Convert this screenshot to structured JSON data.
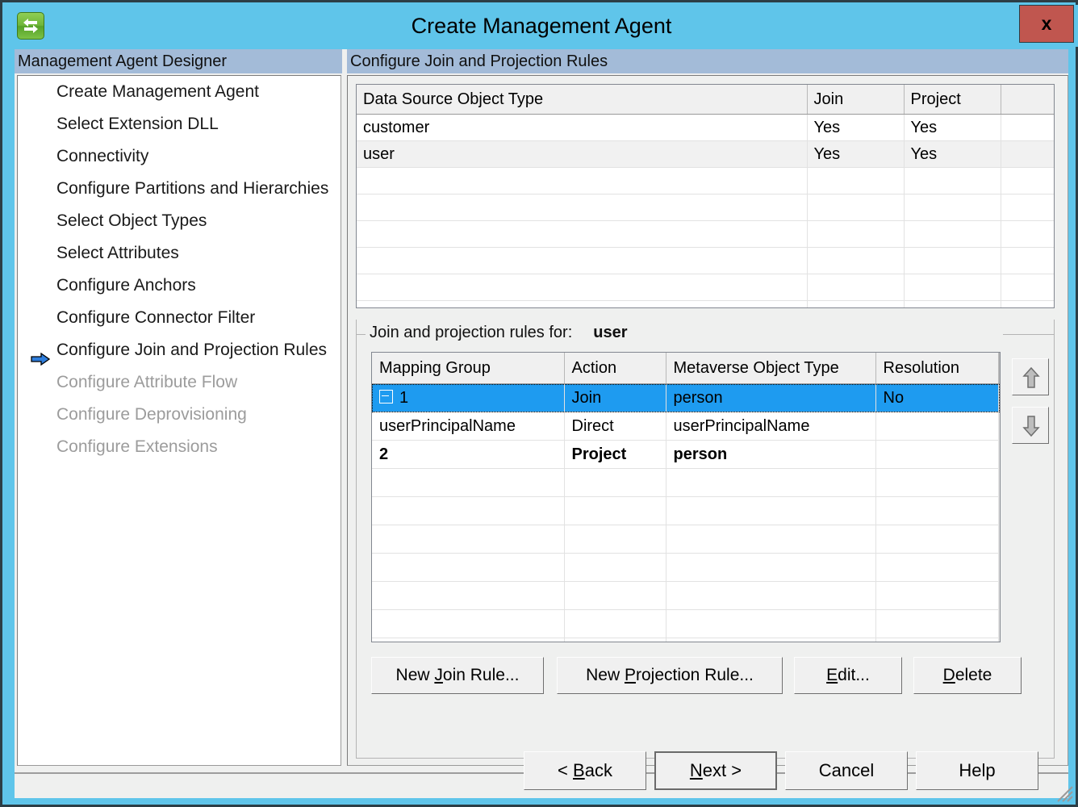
{
  "window": {
    "title": "Create Management Agent",
    "app_icon": "sync-arrows-icon",
    "close_label": "x",
    "accent_titlebar": "#5fc5ea",
    "accent_close": "#c0564f",
    "accent_header": "#a3bbd8",
    "accent_selection": "#1e9bf0"
  },
  "left_panel": {
    "header": "Management Agent Designer",
    "items": [
      {
        "label": "Create Management Agent",
        "state": "done",
        "current": false
      },
      {
        "label": "Select Extension DLL",
        "state": "done",
        "current": false
      },
      {
        "label": "Connectivity",
        "state": "done",
        "current": false
      },
      {
        "label": "Configure Partitions and Hierarchies",
        "state": "done",
        "current": false
      },
      {
        "label": "Select Object Types",
        "state": "done",
        "current": false
      },
      {
        "label": "Select Attributes",
        "state": "done",
        "current": false
      },
      {
        "label": "Configure Anchors",
        "state": "done",
        "current": false
      },
      {
        "label": "Configure Connector Filter",
        "state": "done",
        "current": false
      },
      {
        "label": "Configure Join and Projection Rules",
        "state": "done",
        "current": true
      },
      {
        "label": "Configure Attribute Flow",
        "state": "disabled",
        "current": false
      },
      {
        "label": "Configure Deprovisioning",
        "state": "disabled",
        "current": false
      },
      {
        "label": "Configure Extensions",
        "state": "disabled",
        "current": false
      }
    ]
  },
  "right_panel": {
    "header": "Configure Join and Projection Rules",
    "object_type_grid": {
      "columns": [
        "Data Source Object Type",
        "Join",
        "Project",
        ""
      ],
      "rows": [
        {
          "object_type": "customer",
          "join": "Yes",
          "project": "Yes",
          "blank": "",
          "selected": false
        },
        {
          "object_type": "user",
          "join": "Yes",
          "project": "Yes",
          "blank": "",
          "selected": true
        }
      ],
      "empty_row_count": 7
    },
    "groupbox": {
      "label": "Join and projection rules for:",
      "object": "user",
      "rules_grid": {
        "columns": [
          "Mapping Group",
          "Action",
          "Metaverse Object Type",
          "Resolution",
          ""
        ],
        "rows": [
          {
            "mapping_group": "1",
            "action": "Join",
            "metaverse_object_type": "person",
            "resolution": "No",
            "blank": "",
            "selected": true,
            "expandable": true,
            "child": false,
            "bold": false
          },
          {
            "mapping_group": "userPrincipalName",
            "action": "Direct",
            "metaverse_object_type": "userPrincipalName",
            "resolution": "",
            "blank": "",
            "selected": false,
            "expandable": false,
            "child": true,
            "bold": false
          },
          {
            "mapping_group": "2",
            "action": "Project",
            "metaverse_object_type": "person",
            "resolution": "",
            "blank": "",
            "selected": false,
            "expandable": false,
            "child": false,
            "bold": true
          }
        ],
        "empty_row_count": 8
      },
      "move_up_label": "move-up-icon",
      "move_down_label": "move-down-icon",
      "buttons": {
        "new_join": {
          "pre": "New ",
          "accel": "J",
          "post": "oin Rule..."
        },
        "new_projection": {
          "pre": "New ",
          "accel": "P",
          "post": "rojection Rule..."
        },
        "edit": {
          "pre": "",
          "accel": "E",
          "post": "dit..."
        },
        "delete": {
          "pre": "",
          "accel": "D",
          "post": "elete"
        }
      }
    }
  },
  "footer": {
    "back": {
      "pre": "< ",
      "accel": "B",
      "post": "ack"
    },
    "next": {
      "pre": "",
      "accel": "N",
      "post": "ext  >"
    },
    "cancel": {
      "pre": "Cancel",
      "accel": "",
      "post": ""
    },
    "help": {
      "pre": "Help",
      "accel": "",
      "post": ""
    }
  }
}
